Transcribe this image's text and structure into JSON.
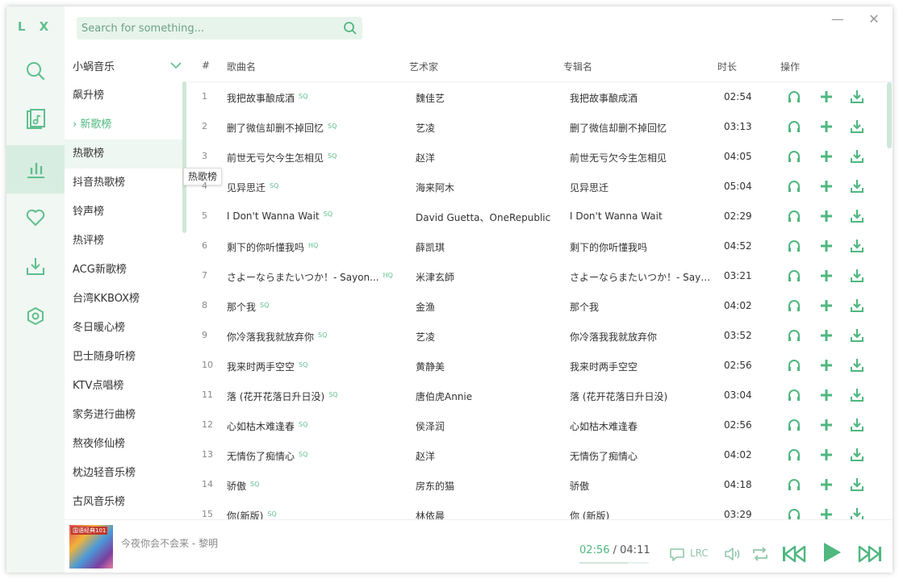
{
  "app": {
    "logo": "L X"
  },
  "rail": [
    "search-icon",
    "music-doc-icon",
    "chart-icon",
    "heart-icon",
    "download-icon",
    "settings-icon"
  ],
  "search": {
    "placeholder": "Search for something..."
  },
  "window_controls": {
    "minimize": "—",
    "close": "✕"
  },
  "board": {
    "source": "小蜗音乐",
    "items": [
      "飙升榜",
      "新歌榜",
      "热歌榜",
      "抖音热歌榜",
      "铃声榜",
      "热评榜",
      "ACG新歌榜",
      "台湾KKBOX榜",
      "冬日暖心榜",
      "巴士随身听榜",
      "KTV点唱榜",
      "家务进行曲榜",
      "熬夜修仙榜",
      "枕边轻音乐榜",
      "古风音乐榜"
    ],
    "current_marker": "›",
    "tooltip": "热歌榜"
  },
  "table": {
    "headers": {
      "num": "#",
      "name": "歌曲名",
      "artist": "艺术家",
      "album": "专辑名",
      "duration": "时长",
      "actions": "操作"
    },
    "rows": [
      {
        "num": "1",
        "name": "我把故事酿成酒",
        "quality": "SQ",
        "artist": "魏佳艺",
        "album": "我把故事酿成酒",
        "duration": "02:54"
      },
      {
        "num": "2",
        "name": "删了微信却删不掉回忆",
        "quality": "SQ",
        "artist": "艺凌",
        "album": "删了微信却删不掉回忆",
        "duration": "03:13"
      },
      {
        "num": "3",
        "name": "前世无亏欠今生怎相见",
        "quality": "SQ",
        "artist": "赵洋",
        "album": "前世无亏欠今生怎相见",
        "duration": "04:05"
      },
      {
        "num": "4",
        "name": "见异思迁",
        "quality": "SQ",
        "artist": "海来阿木",
        "album": "见异思迁",
        "duration": "05:04"
      },
      {
        "num": "5",
        "name": "I Don't Wanna Wait",
        "quality": "SQ",
        "artist": "David Guetta、OneRepublic",
        "album": "I Don't Wanna Wait",
        "duration": "02:29"
      },
      {
        "num": "6",
        "name": "剩下的你听懂我吗",
        "quality": "HQ",
        "artist": "薛凯琪",
        "album": "剩下的你听懂我吗",
        "duration": "04:52"
      },
      {
        "num": "7",
        "name": "さよーならまたいつか！- Sayon...",
        "quality": "HQ",
        "artist": "米津玄師",
        "album": "さよーならまたいつか！- Sayo...",
        "duration": "03:21"
      },
      {
        "num": "8",
        "name": "那个我",
        "quality": "SQ",
        "artist": "金渔",
        "album": "那个我",
        "duration": "04:02"
      },
      {
        "num": "9",
        "name": "你冷落我我就放弃你",
        "quality": "SQ",
        "artist": "艺凌",
        "album": "你冷落我我就放弃你",
        "duration": "03:52"
      },
      {
        "num": "10",
        "name": "我来时两手空空",
        "quality": "SQ",
        "artist": "黄静美",
        "album": "我来时两手空空",
        "duration": "02:56"
      },
      {
        "num": "11",
        "name": "落 (花开花落日升日没)",
        "quality": "SQ",
        "artist": "唐伯虎Annie",
        "album": "落 (花开花落日升日没)",
        "duration": "03:04"
      },
      {
        "num": "12",
        "name": "心如枯木难逢春",
        "quality": "SQ",
        "artist": "侯泽润",
        "album": "心如枯木难逢春",
        "duration": "02:56"
      },
      {
        "num": "13",
        "name": "无情伤了痴情心",
        "quality": "SQ",
        "artist": "赵洋",
        "album": "无情伤了痴情心",
        "duration": "04:02"
      },
      {
        "num": "14",
        "name": "骄傲",
        "quality": "SQ",
        "artist": "房东的猫",
        "album": "骄傲",
        "duration": "04:18"
      },
      {
        "num": "15",
        "name": "你(新版)",
        "quality": "SQ",
        "artist": "林依晨",
        "album": "你 (新版)",
        "duration": "03:29"
      }
    ],
    "actions": [
      "headphones-icon",
      "add-icon",
      "download-icon"
    ]
  },
  "player": {
    "cover_caption": "国语经典101",
    "track": "今夜你会不会来 - 黎明",
    "current_time": "02:56",
    "separator": "/",
    "total_time": "04:11",
    "progress": 0.7,
    "lrc": "LRC"
  },
  "colors": {
    "accent": "#4fb77f",
    "rail_bg": "#f1f7f3",
    "search_bg": "#e7f4ec"
  }
}
